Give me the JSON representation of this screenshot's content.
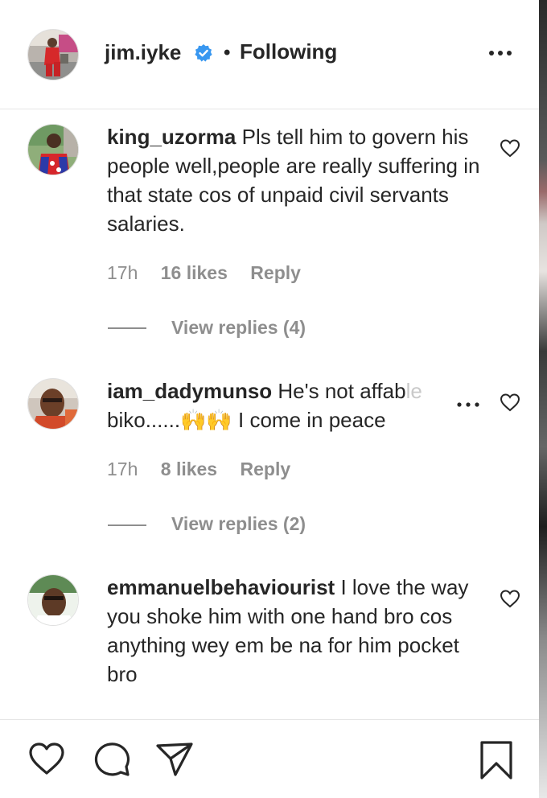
{
  "post": {
    "username": "jim.iyke",
    "separator": "•",
    "follow_status": "Following"
  },
  "comments": [
    {
      "username": "king_uzorma",
      "text": "Pls tell him to govern his people well,people are really suffering in that state cos of unpaid civil servants salaries.",
      "time": "17h",
      "likes": "16 likes",
      "reply_label": "Reply",
      "view_replies": "View replies (4)"
    },
    {
      "username": "iam_dadymunso",
      "text_start": "He's not affab",
      "text_faded": "le",
      "text_line2": "biko......🙌🙌 I come in peace",
      "time": "17h",
      "likes": "8 likes",
      "reply_label": "Reply",
      "view_replies": "View replies (2)"
    },
    {
      "username": "emmanuelbehaviourist",
      "text": "I love the way you shoke him with one hand bro cos anything wey em be na for him pocket bro"
    }
  ],
  "icons": {
    "verified": "verified-badge-icon",
    "more": "more-options-icon",
    "like": "heart-icon",
    "comment": "comment-icon",
    "share": "share-icon",
    "save": "bookmark-icon"
  },
  "colors": {
    "text": "#262626",
    "secondary": "#8e8e8e",
    "verified_blue": "#3897f0",
    "divider": "#e6e6e6"
  }
}
